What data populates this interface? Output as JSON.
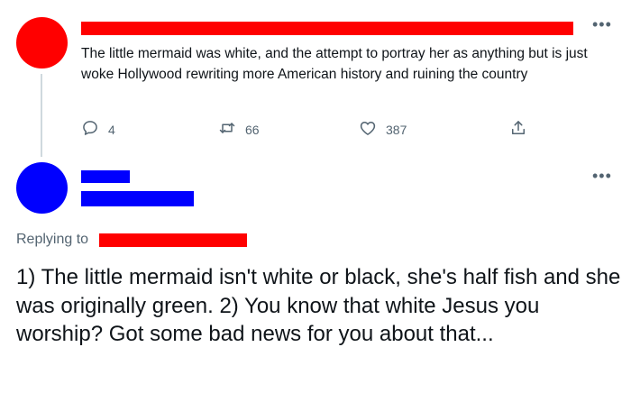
{
  "tweet1": {
    "text": "The little mermaid was white, and the attempt to portray her as anything but is just woke Hollywood rewriting more American history and ruining the country",
    "replies": "4",
    "retweets": "66",
    "likes": "387"
  },
  "tweet2": {
    "replying_to_label": "Replying to",
    "text": "1) The little mermaid isn't white or black, she's half fish and she was originally green. 2) You know that white Jesus you worship? Got some bad news for you about that..."
  },
  "colors": {
    "redaction_red": "#ff0000",
    "redaction_blue": "#0000ff",
    "muted_text": "#536471"
  },
  "icons": [
    "reply-icon",
    "retweet-icon",
    "like-icon",
    "share-icon",
    "more-options-icon"
  ]
}
